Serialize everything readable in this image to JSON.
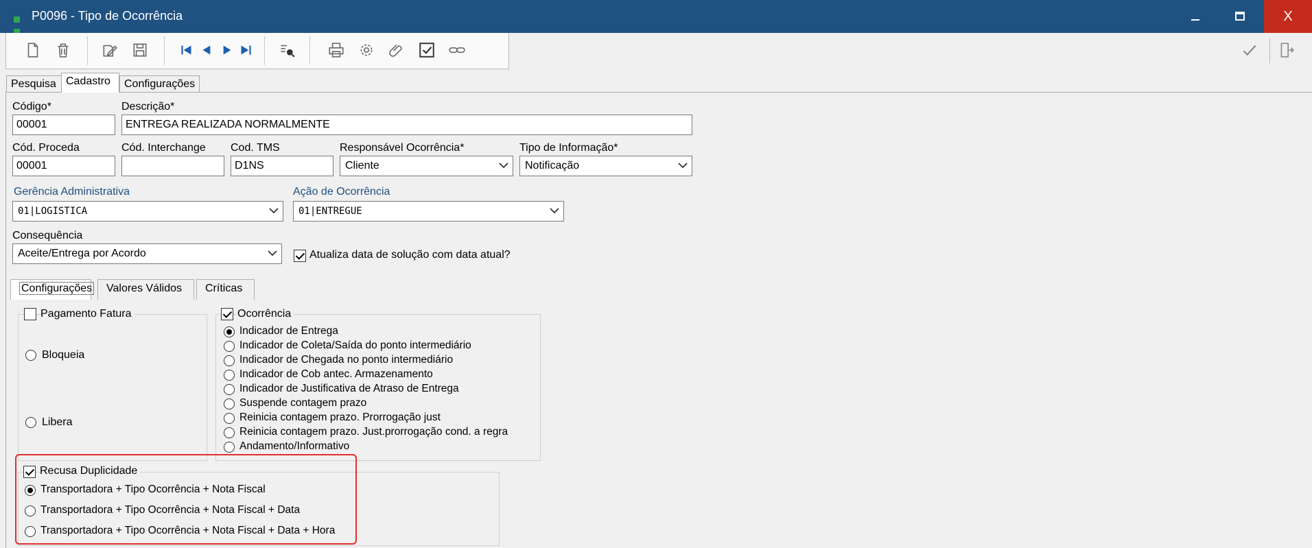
{
  "window": {
    "title": "P0096 - Tipo de Ocorrência",
    "minimize": "—",
    "maximize": "▢",
    "close": "X"
  },
  "tabs": [
    {
      "label": "Pesquisa"
    },
    {
      "label": "Cadastro"
    },
    {
      "label": "Configurações"
    }
  ],
  "form": {
    "codigo_label": "Código*",
    "codigo_value": "00001",
    "descricao_label": "Descrição*",
    "descricao_value": "ENTREGA REALIZADA NORMALMENTE",
    "cod_proceda_label": "Cód. Proceda",
    "cod_proceda_value": "00001",
    "cod_interchange_label": "Cód. Interchange",
    "cod_interchange_value": "",
    "cod_tms_label": "Cod. TMS",
    "cod_tms_value": "D1NS",
    "responsavel_label": "Responsável Ocorrência*",
    "responsavel_value": "Cliente",
    "tipo_info_label": "Tipo de Informação*",
    "tipo_info_value": "Notificação",
    "gerencia_label": "Gerência Administrativa",
    "gerencia_value": "01|LOGISTICA",
    "acao_label": "Ação de Ocorrência",
    "acao_value": "01|ENTREGUE",
    "consequencia_label": "Consequência",
    "consequencia_value": "Aceite/Entrega por Acordo",
    "atualiza_label": "Atualiza data de solução com data atual?",
    "atualiza_checked": true
  },
  "subtabs": [
    {
      "label": "Configurações"
    },
    {
      "label": "Valores Válidos"
    },
    {
      "label": "Críticas"
    }
  ],
  "pagamento": {
    "label": "Pagamento Fatura",
    "checked": false,
    "options": [
      "Bloqueia",
      "Libera"
    ]
  },
  "ocorrencia": {
    "label": "Ocorrência",
    "checked": true,
    "options": [
      "Indicador de Entrega",
      "Indicador de Coleta/Saída do ponto intermediário",
      "Indicador de Chegada no ponto intermediário",
      "Indicador de Cob antec. Armazenamento",
      "Indicador de Justificativa de Atraso de Entrega",
      "Suspende contagem prazo",
      "Reinicia contagem prazo. Prorrogação just",
      "Reinicia contagem prazo. Just.prorrogação cond. a regra",
      "Andamento/Informativo"
    ],
    "selected": 0
  },
  "duplicidade": {
    "label": "Recusa Duplicidade",
    "checked": true,
    "options": [
      "Transportadora + Tipo Ocorrência + Nota Fiscal",
      "Transportadora + Tipo Ocorrência + Nota Fiscal + Data",
      "Transportadora + Tipo Ocorrência + Nota Fiscal + Data + Hora"
    ],
    "selected": 0
  },
  "colors": {
    "titlebar": "#1f5181",
    "close": "#c42b1c",
    "highlight": "#e03030",
    "field_label_blue": "#1f5181"
  }
}
